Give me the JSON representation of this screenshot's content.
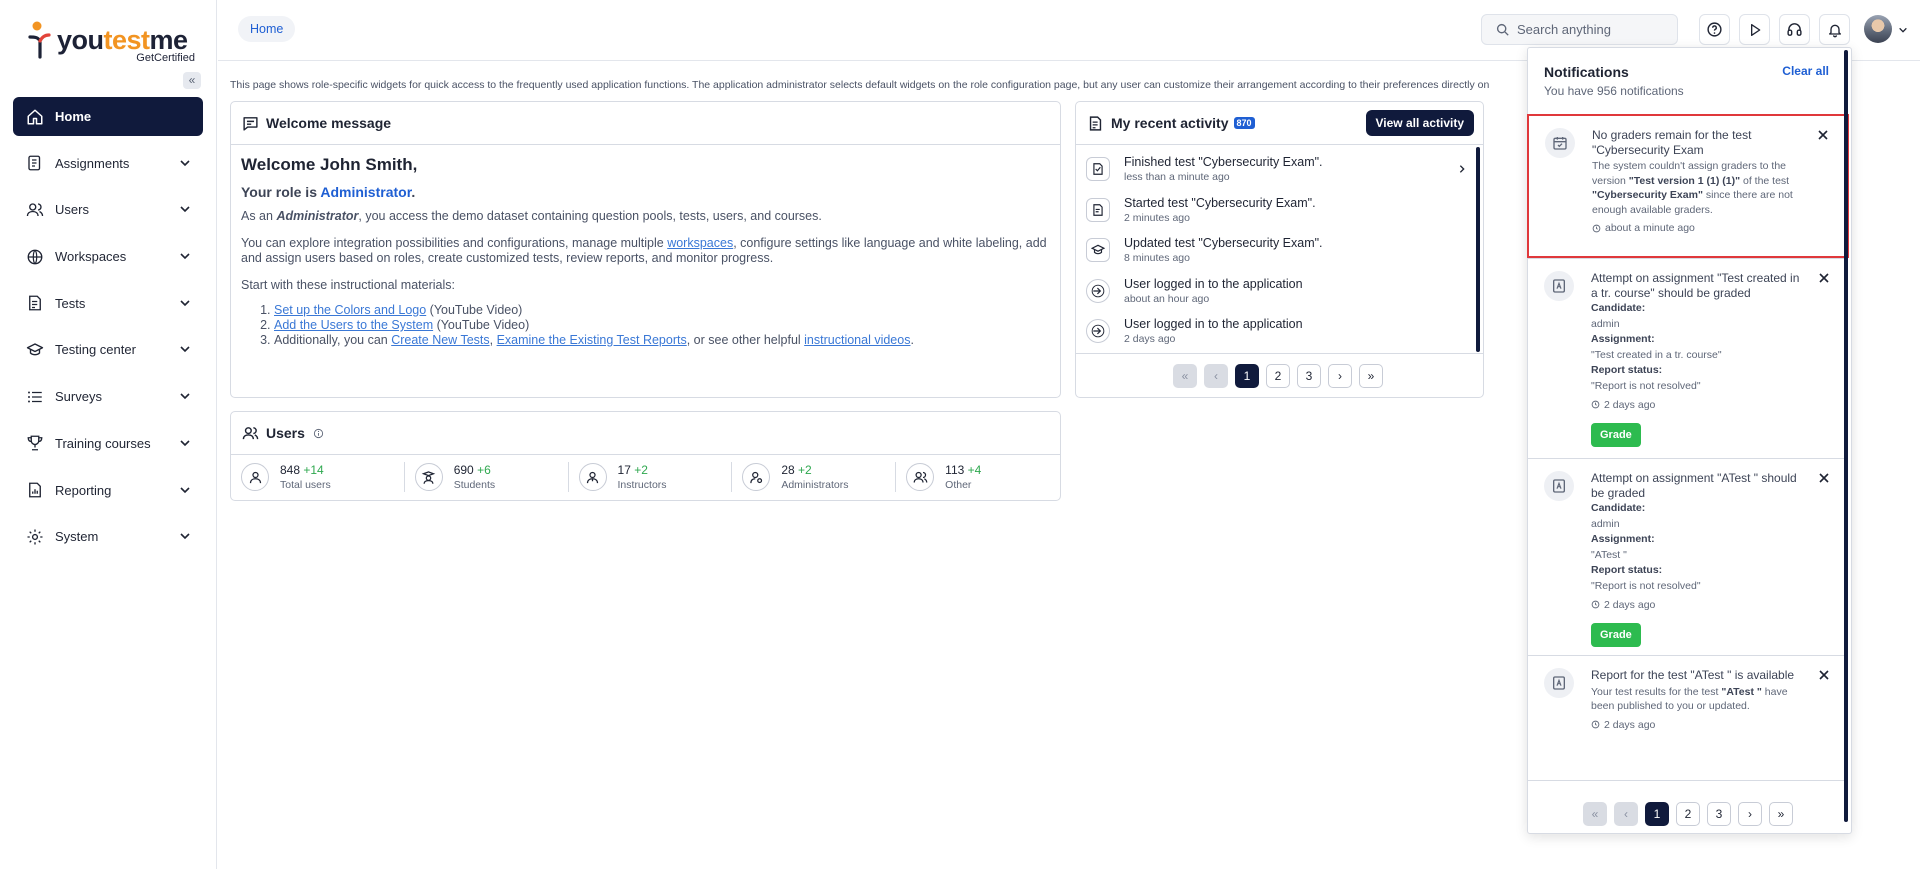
{
  "brand": {
    "name_a": "you",
    "name_b": "test",
    "name_c": "me",
    "sub": "GetCertified"
  },
  "sidebar": {
    "collapse_icon": "«",
    "items": [
      {
        "label": "Home",
        "icon": "home-icon"
      },
      {
        "label": "Assignments",
        "icon": "assignments-icon"
      },
      {
        "label": "Users",
        "icon": "users-icon"
      },
      {
        "label": "Workspaces",
        "icon": "globe-icon"
      },
      {
        "label": "Tests",
        "icon": "tests-icon"
      },
      {
        "label": "Testing center",
        "icon": "testing-center-icon"
      },
      {
        "label": "Surveys",
        "icon": "list-icon"
      },
      {
        "label": "Training courses",
        "icon": "trophy-icon"
      },
      {
        "label": "Reporting",
        "icon": "report-icon"
      },
      {
        "label": "System",
        "icon": "gear-icon"
      }
    ]
  },
  "topbar": {
    "breadcrumb": "Home",
    "search_placeholder": "Search anything"
  },
  "intro": "This page shows role-specific widgets for quick access to the frequently used application functions. The application administrator selects default widgets on the role configuration page, but any user can customize their arrangement according to their preferences directly on",
  "welcome": {
    "header": "Welcome message",
    "title": "Welcome John Smith,",
    "role_prefix": "Your role is ",
    "role": "Administrator",
    "role_suffix": ".",
    "p1_a": "As an ",
    "p1_b": "Administrator",
    "p1_c": ", you access the demo dataset containing question pools, tests, users, and courses.",
    "p2_a": "You can explore integration possibilities and configurations, manage multiple ",
    "p2_link": "workspaces",
    "p2_b": ", configure settings like language and white labeling, add and assign users based on roles, create customized tests, review reports, and monitor progress.",
    "p3": "Start with these instructional materials:",
    "l1_link": "Set up the Colors and Logo",
    "l1_tail": " (YouTube Video)",
    "l2_link": "Add the Users to the System",
    "l2_tail": " (YouTube Video)",
    "l3_a": "Additionally, you can ",
    "l3_link1": "Create New Tests",
    "l3_sep": ", ",
    "l3_link2": "Examine the Existing Test Reports",
    "l3_b": ", or see other helpful ",
    "l3_link3": "instructional videos",
    "l3_c": "."
  },
  "activity": {
    "header": "My recent activity",
    "badge": "870",
    "view_all": "View all activity",
    "items": [
      {
        "title": "Finished test \"Cybersecurity Exam\".",
        "time": "less than a minute ago"
      },
      {
        "title": "Started test \"Cybersecurity Exam\".",
        "time": "2 minutes ago"
      },
      {
        "title": "Updated test \"Cybersecurity Exam\".",
        "time": "8 minutes ago"
      },
      {
        "title": "User logged in to the application",
        "time": "about an hour ago"
      },
      {
        "title": "User logged in to the application",
        "time": "2 days ago"
      }
    ],
    "pager": {
      "first": "«",
      "prev": "‹",
      "pages": [
        "1",
        "2",
        "3"
      ],
      "next": "›",
      "last": "»"
    }
  },
  "users_widget": {
    "header": "Users",
    "stats": [
      {
        "value": "848",
        "delta": "+14",
        "label": "Total users"
      },
      {
        "value": "690",
        "delta": "+6",
        "label": "Students"
      },
      {
        "value": "17",
        "delta": "+2",
        "label": "Instructors"
      },
      {
        "value": "28",
        "delta": "+2",
        "label": "Administrators"
      },
      {
        "value": "113",
        "delta": "+4",
        "label": "Other"
      }
    ]
  },
  "notifications": {
    "title": "Notifications",
    "subtitle": "You have 956 notifications",
    "clear_all": "Clear all",
    "items": [
      {
        "title": "No graders remain for the test \"Cybersecurity Exam",
        "body_a": "The system couldn't assign graders to the version ",
        "body_b": "\"Test version 1 (1) (1)\"",
        "body_c": " of the test ",
        "body_d": "\"Cybersecurity Exam\"",
        "body_e": " since there are not enough available graders.",
        "time": "about a minute ago"
      },
      {
        "title": "Attempt on assignment \"Test created in a tr. course\" should be graded",
        "candidate_label": "Candidate:",
        "candidate": "admin",
        "assignment_label": "Assignment:",
        "assignment": "\"Test created in a tr. course\"",
        "status_label": "Report status:",
        "status": "\"Report is not resolved\"",
        "time": "2 days ago",
        "action": "Grade"
      },
      {
        "title": "Attempt on assignment \"ATest \" should be graded",
        "candidate_label": "Candidate:",
        "candidate": "admin",
        "assignment_label": "Assignment:",
        "assignment": "\"ATest \"",
        "status_label": "Report status:",
        "status": "\"Report is not resolved\"",
        "time": "2 days ago",
        "action": "Grade"
      },
      {
        "title": "Report for the test \"ATest \" is available",
        "body_a": "Your test results for the test ",
        "body_b": "\"ATest \"",
        "body_c": " have been published to you or updated.",
        "time": "2 days ago"
      }
    ],
    "pager": {
      "first": "«",
      "prev": "‹",
      "pages": [
        "1",
        "2",
        "3"
      ],
      "next": "›",
      "last": "»"
    }
  }
}
